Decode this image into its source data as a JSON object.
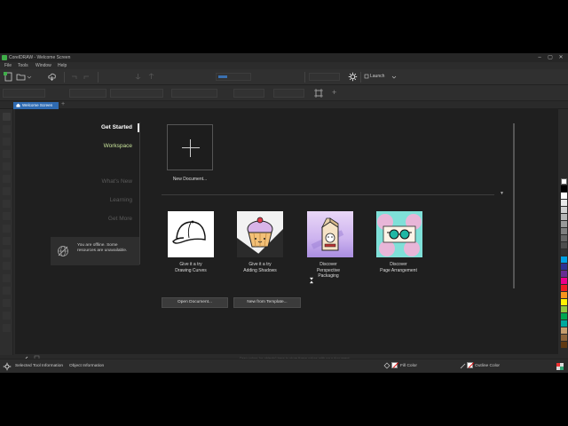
{
  "window": {
    "title": "CorelDRAW - Welcome Screen",
    "controls": [
      "–",
      "▢",
      "✕"
    ]
  },
  "menu": {
    "items": [
      "File",
      "Tools",
      "Window",
      "Help"
    ]
  },
  "toolbar": {
    "launch_label": "Launch"
  },
  "tabs": {
    "active": "Welcome Screen",
    "add_label": "+"
  },
  "nav": {
    "get_started": "Get Started",
    "workspace": "Workspace",
    "whats_new": "What's New",
    "learning": "Learning",
    "get_more": "Get More"
  },
  "offline": {
    "message": "You are offline. Some resources are unavailable."
  },
  "new_document": {
    "label": "New Document..."
  },
  "cards": [
    {
      "line1": "Give it a try",
      "line2": "Drawing Curves",
      "line3": ""
    },
    {
      "line1": "Give it a try",
      "line2": "Adding Shadows",
      "line3": ""
    },
    {
      "line1": "Discover",
      "line2": "Perspective",
      "line3": "Packaging"
    },
    {
      "line1": "Discover",
      "line2": "Page Arrangement",
      "line3": ""
    }
  ],
  "buttons": {
    "open_document": "Open Document...",
    "new_from_template": "New from Template..."
  },
  "docpalette": {
    "hint": "Drag colors (or objects) here to store these colors with your document"
  },
  "status": {
    "selected_tool": "Selected Tool Information",
    "object_info": "Object Information",
    "fill_color": "Fill Color",
    "outline_color": "Outline Color"
  },
  "colors": {
    "accent": "#2f6bb2",
    "workspace_green": "#c7e39a",
    "nav_inactive": "#5a5a5a",
    "background": "#1f1f1f"
  }
}
